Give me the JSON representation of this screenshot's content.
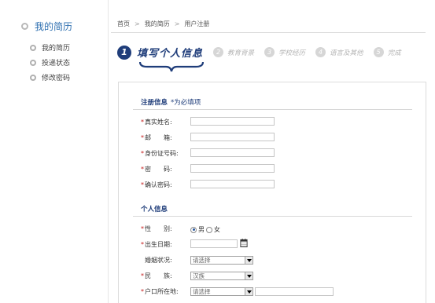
{
  "sidebar": {
    "title": "我的简历",
    "items": [
      {
        "label": "我的简历"
      },
      {
        "label": "投递状态"
      },
      {
        "label": "修改密码"
      }
    ]
  },
  "breadcrumb": [
    "首页",
    "我的简历",
    "用户注册"
  ],
  "steps": [
    {
      "num": "1",
      "label": "填写个人信息",
      "active": true
    },
    {
      "num": "2",
      "label": "教育背景"
    },
    {
      "num": "3",
      "label": "学校经历"
    },
    {
      "num": "4",
      "label": "语言及其他"
    },
    {
      "num": "5",
      "label": "完成"
    }
  ],
  "form": {
    "registration": {
      "title": "注册信息",
      "note": "*为必填项",
      "fields": [
        {
          "label": "真实姓名:",
          "value": ""
        },
        {
          "label": "邮　　箱:",
          "value": ""
        },
        {
          "label": "身份证号码:",
          "value": ""
        },
        {
          "label": "密　　码:",
          "value": ""
        },
        {
          "label": "确认密码:",
          "value": ""
        }
      ]
    },
    "personal": {
      "title": "个人信息",
      "gender_label": "性　　别:",
      "gender_options": [
        "男",
        "女"
      ],
      "gender_selected": "男",
      "birth_label": "出生日期:",
      "marital_label": "婚姻状况:",
      "marital_value": "请选择",
      "ethnicity_label": "民　　族:",
      "ethnicity_value": "汉族",
      "hukou_label": "户口所在地:",
      "hukou_value": "请选择"
    }
  },
  "colors": {
    "accent": "#1f3d7a",
    "required": "#c41a1a",
    "link": "#2e6fb0"
  }
}
